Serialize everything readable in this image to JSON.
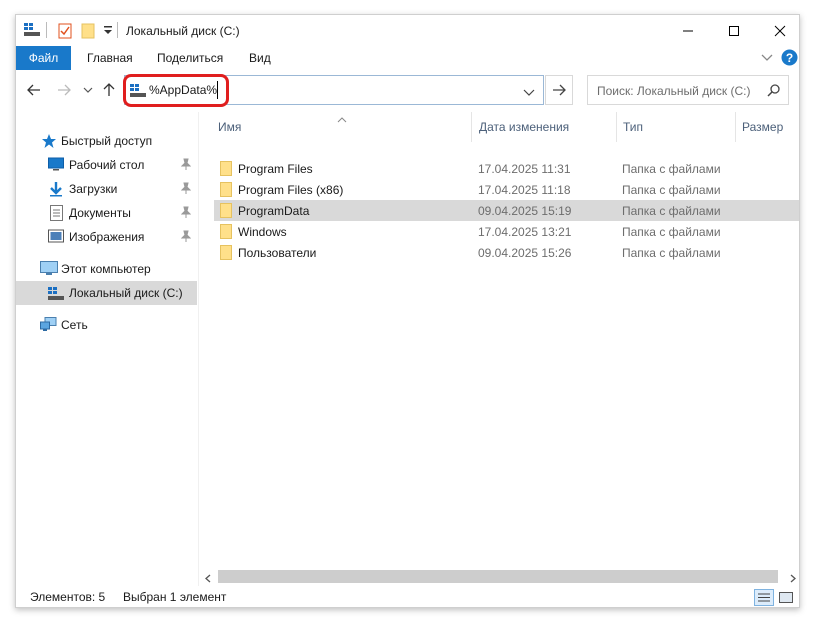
{
  "window": {
    "title": "Локальный диск (C:)"
  },
  "ribbon": {
    "tabs": [
      "Файл",
      "Главная",
      "Поделиться",
      "Вид"
    ]
  },
  "address": {
    "value": "%AppData%"
  },
  "search": {
    "placeholder": "Поиск: Локальный диск (C:)"
  },
  "navpane": {
    "quick_access": "Быстрый доступ",
    "items": [
      {
        "label": "Рабочий стол",
        "icon": "desktop-icon",
        "pinned": true
      },
      {
        "label": "Загрузки",
        "icon": "download-icon",
        "pinned": true
      },
      {
        "label": "Документы",
        "icon": "documents-icon",
        "pinned": true
      },
      {
        "label": "Изображения",
        "icon": "pictures-icon",
        "pinned": true
      }
    ],
    "this_pc": "Этот компьютер",
    "local_disk": "Локальный диск (C:)",
    "network": "Сеть"
  },
  "columns": {
    "name": "Имя",
    "date": "Дата изменения",
    "type": "Тип",
    "size": "Размер"
  },
  "files": [
    {
      "name": "Program Files",
      "date": "17.04.2025 11:31",
      "type": "Папка с файлами"
    },
    {
      "name": "Program Files (x86)",
      "date": "17.04.2025 11:18",
      "type": "Папка с файлами"
    },
    {
      "name": "ProgramData",
      "date": "09.04.2025 15:19",
      "type": "Папка с файлами"
    },
    {
      "name": "Windows",
      "date": "17.04.2025 13:21",
      "type": "Папка с файлами"
    },
    {
      "name": "Пользователи",
      "date": "09.04.2025 15:26",
      "type": "Папка с файлами"
    }
  ],
  "status": {
    "count": "Элементов: 5",
    "selected": "Выбран 1 элемент"
  },
  "colors": {
    "accent": "#1979ca",
    "highlight_border": "#e01e1e",
    "folder": "#ffe08a",
    "selection": "#d9d9d9"
  }
}
